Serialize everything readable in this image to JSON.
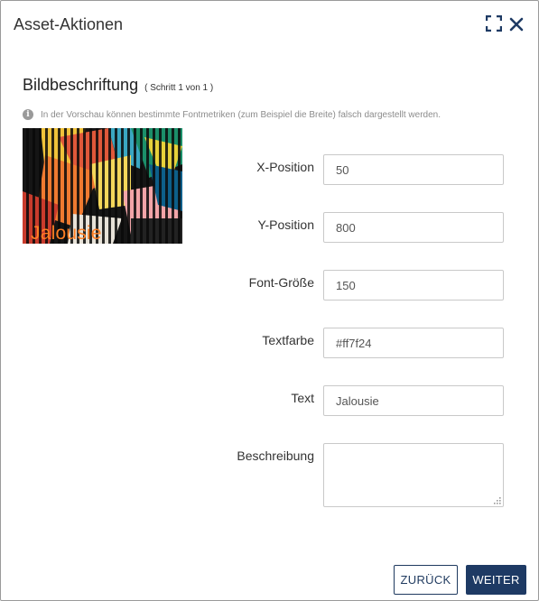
{
  "dialog": {
    "title": "Asset-Aktionen",
    "maximize_icon": "maximize-icon",
    "close_icon": "close-icon"
  },
  "step": {
    "title": "Bildbeschriftung",
    "subtitle": "( Schritt 1 von 1 )"
  },
  "hint": {
    "icon": "info-icon",
    "text": "In der Vorschau können bestimmte Fontmetriken (zum Beispiel die Breite) falsch dargestellt werden."
  },
  "preview": {
    "caption": "Jalousie",
    "caption_color": "#ff7f24"
  },
  "form": {
    "x_position": {
      "label": "X-Position",
      "value": "50"
    },
    "y_position": {
      "label": "Y-Position",
      "value": "800"
    },
    "font_size": {
      "label": "Font-Größe",
      "value": "150"
    },
    "text_color": {
      "label": "Textfarbe",
      "value": "#ff7f24"
    },
    "text": {
      "label": "Text",
      "value": "Jalousie"
    },
    "description": {
      "label": "Beschreibung",
      "value": ""
    }
  },
  "footer": {
    "back_label": "ZURÜCK",
    "next_label": "WEITER"
  },
  "colors": {
    "primary": "#1e3a64",
    "text_color_value": "#ff7f24"
  }
}
